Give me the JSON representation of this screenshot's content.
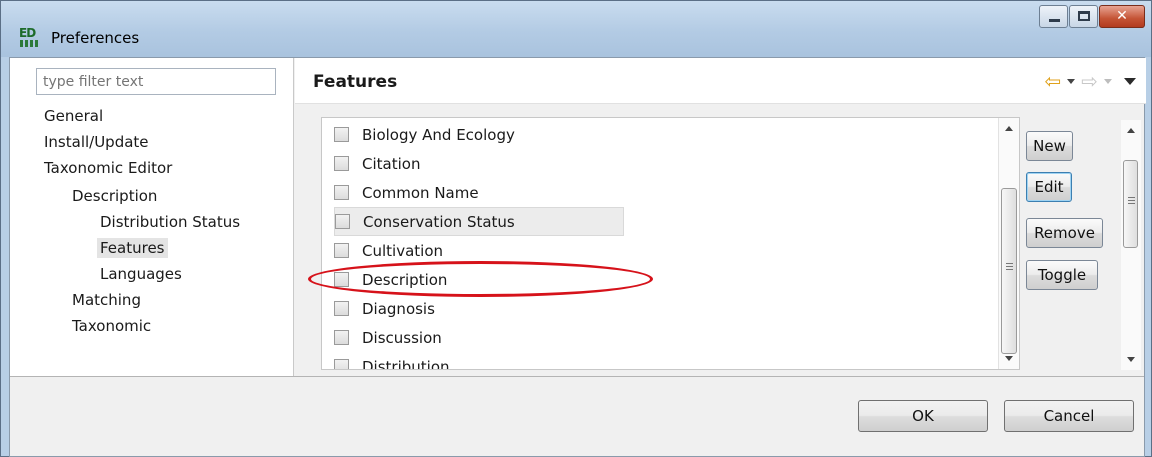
{
  "window": {
    "title": "Preferences",
    "icon": "eclipse-app-icon",
    "app_icon_text": "ED"
  },
  "left": {
    "filter_placeholder": "type filter text",
    "tree": [
      {
        "label": "General",
        "level": 0,
        "selected": false
      },
      {
        "label": "Install/Update",
        "level": 0,
        "selected": false
      },
      {
        "label": "Taxonomic Editor",
        "level": 0,
        "selected": false
      },
      {
        "label": "Description",
        "level": 1,
        "selected": false
      },
      {
        "label": "Distribution Status",
        "level": 2,
        "selected": false
      },
      {
        "label": "Features",
        "level": 2,
        "selected": true
      },
      {
        "label": "Languages",
        "level": 2,
        "selected": false
      },
      {
        "label": "Matching",
        "level": 1,
        "selected": false
      },
      {
        "label": "Taxonomic",
        "level": 1,
        "selected": false
      }
    ]
  },
  "main": {
    "title": "Features",
    "features": [
      {
        "label": "Biology And Ecology",
        "checked": false
      },
      {
        "label": "Citation",
        "checked": false
      },
      {
        "label": "Common Name",
        "checked": false
      },
      {
        "label": "Conservation Status",
        "checked": false,
        "highlighted": true
      },
      {
        "label": "Cultivation",
        "checked": false
      },
      {
        "label": "Description",
        "checked": false
      },
      {
        "label": "Diagnosis",
        "checked": false
      },
      {
        "label": "Discussion",
        "checked": false
      },
      {
        "label": "Distribution",
        "checked": false
      }
    ],
    "buttons": {
      "new": "New",
      "edit": "Edit",
      "remove": "Remove",
      "toggle": "Toggle"
    }
  },
  "footer": {
    "ok": "OK",
    "cancel": "Cancel"
  },
  "colors": {
    "annotation": "#d6121a",
    "titlebar": "#b8cfe6",
    "back_arrow": "#e0a21c"
  }
}
